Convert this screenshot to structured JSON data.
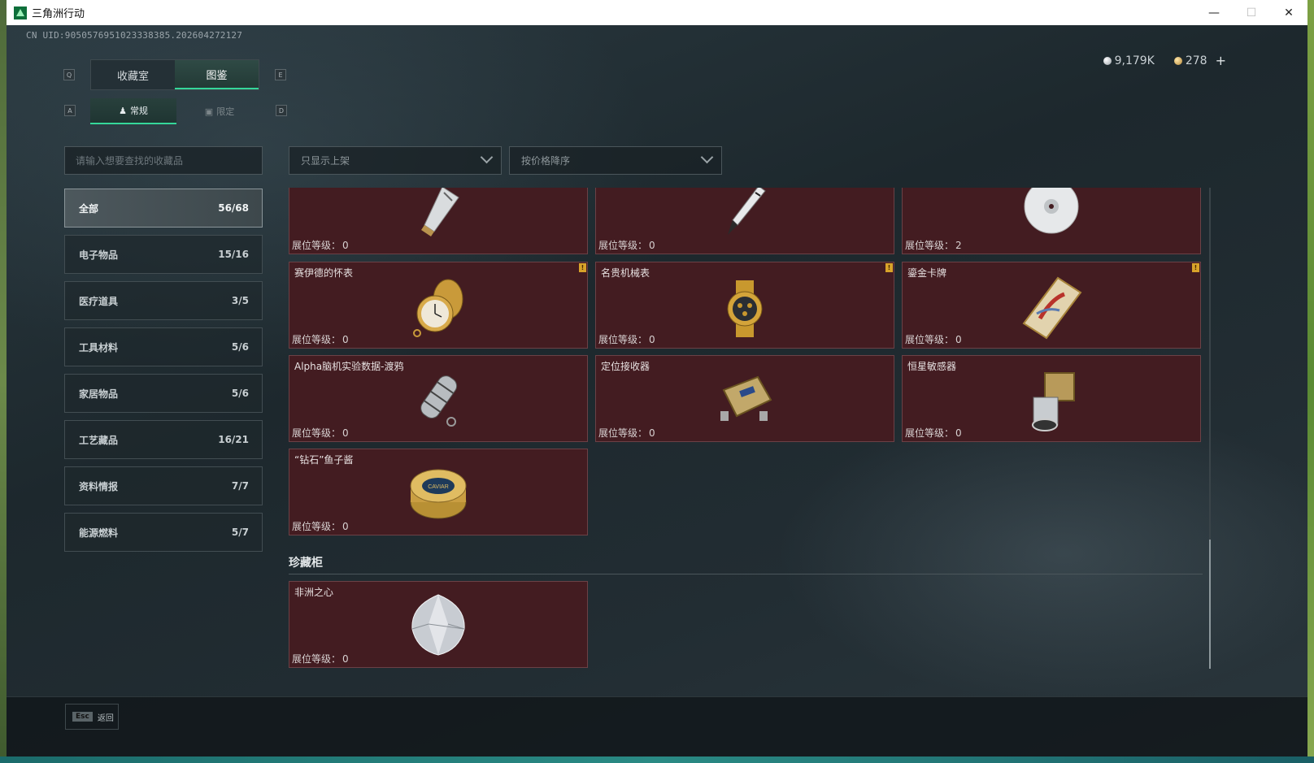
{
  "window": {
    "title": "三角洲行动"
  },
  "header": {
    "uid": "CN UID:9050576951023338385.202604272127",
    "currency": [
      {
        "type": "silver",
        "value": "9,179K"
      },
      {
        "type": "gold",
        "value": "278"
      }
    ],
    "plus_label": "+"
  },
  "tabs": {
    "hint_left": "Q",
    "hint_right": "E",
    "items": [
      {
        "label": "收藏室",
        "active": false
      },
      {
        "label": "图鉴",
        "active": true
      }
    ]
  },
  "subtabs": {
    "hint_left": "A",
    "hint_right": "D",
    "items": [
      {
        "label": "常规",
        "icon": "person-icon",
        "active": true
      },
      {
        "label": "限定",
        "icon": "frame-icon",
        "active": false
      }
    ]
  },
  "search": {
    "placeholder": "请输入想要查找的收藏品"
  },
  "filters": {
    "display": "只显示上架",
    "sort": "按价格降序"
  },
  "categories": [
    {
      "label": "全部",
      "count": "56/68",
      "active": true
    },
    {
      "label": "电子物品",
      "count": "15/16"
    },
    {
      "label": "医疗道具",
      "count": "3/5"
    },
    {
      "label": "工具材料",
      "count": "5/6"
    },
    {
      "label": "家居物品",
      "count": "5/6"
    },
    {
      "label": "工艺藏品",
      "count": "16/21"
    },
    {
      "label": "资料情报",
      "count": "7/7"
    },
    {
      "label": "能源燃料",
      "count": "5/7"
    }
  ],
  "level_label": "展位等级：",
  "items": [
    {
      "name": "",
      "level": "0",
      "icon": "usb-drive-icon",
      "badge": false
    },
    {
      "name": "",
      "level": "0",
      "icon": "fountain-pen-icon",
      "badge": false
    },
    {
      "name": "",
      "level": "2",
      "icon": "cd-disc-icon",
      "badge": false
    },
    {
      "name": "赛伊德的怀表",
      "level": "0",
      "icon": "pocket-watch-icon",
      "badge": true
    },
    {
      "name": "名贵机械表",
      "level": "0",
      "icon": "wristwatch-icon",
      "badge": true
    },
    {
      "name": "鎏金卡牌",
      "level": "0",
      "icon": "gilded-card-icon",
      "badge": true
    },
    {
      "name": "Alpha脑机实验数据-渡鸦",
      "level": "0",
      "icon": "data-capsule-icon",
      "badge": false
    },
    {
      "name": "定位接收器",
      "level": "0",
      "icon": "receiver-device-icon",
      "badge": false
    },
    {
      "name": "恒星敏感器",
      "level": "0",
      "icon": "star-sensor-icon",
      "badge": false
    },
    {
      "name": "“钻石”鱼子酱",
      "level": "0",
      "icon": "caviar-tin-icon",
      "badge": false,
      "tin_label": "CAVIAR"
    }
  ],
  "badge_symbol": "!",
  "treasure": {
    "title": "珍藏柜",
    "items": [
      {
        "name": "非洲之心",
        "level": "0",
        "icon": "diamond-icon"
      }
    ]
  },
  "footer": {
    "key": "Esc",
    "label": "返回"
  },
  "colors": {
    "accent": "#35d79a",
    "card_bg": "#431c21",
    "badge": "#d8a32a"
  }
}
